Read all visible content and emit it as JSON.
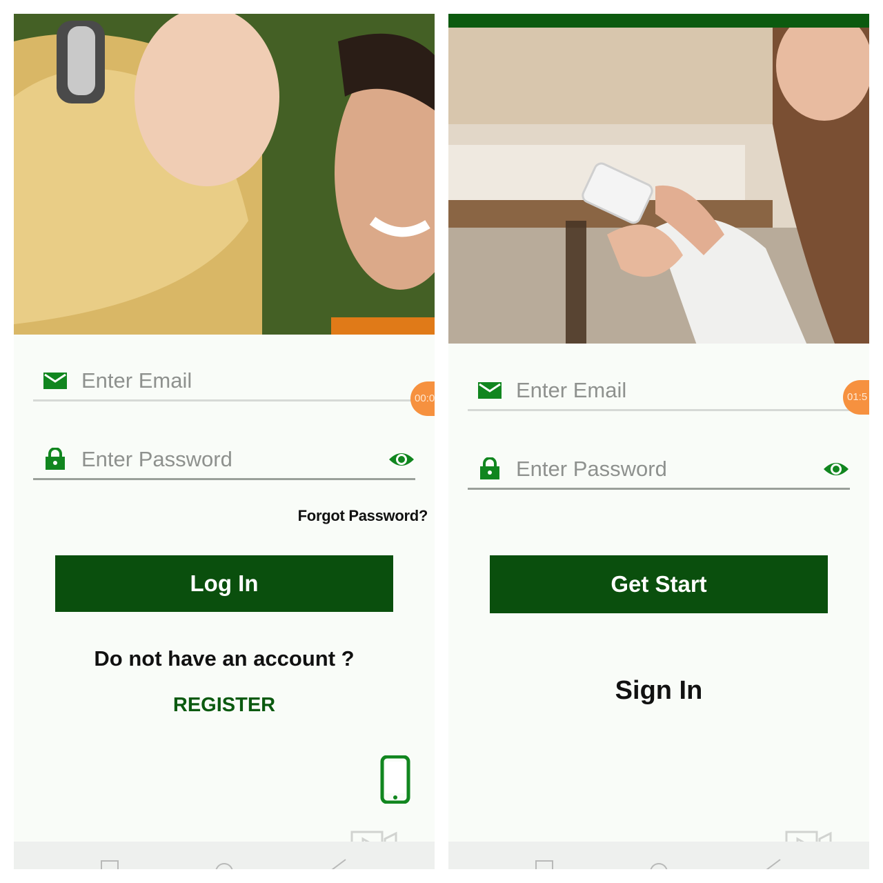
{
  "login_screen": {
    "email_placeholder": "Enter Email",
    "password_placeholder": "Enter Password",
    "timer_text": "00:0",
    "forgot_label": "Forgot Password?",
    "login_label": "Log In",
    "no_account_text": "Do not have an account ?",
    "register_label": "REGISTER",
    "icons": [
      "mail-icon",
      "lock-icon",
      "eye-icon",
      "smartphone-icon",
      "screen-record-icon"
    ]
  },
  "signup_screen": {
    "email_placeholder": "Enter Email",
    "password_placeholder": "Enter Password",
    "timer_text": "01:5",
    "get_start_label": "Get Start",
    "sign_in_label": "Sign In",
    "icons": [
      "mail-icon",
      "lock-icon",
      "eye-icon",
      "screen-record-icon"
    ]
  },
  "colors": {
    "brand_green": "#0a4f0d",
    "icon_green": "#11861f",
    "timer_orange": "#f6913f",
    "background": "#f9fcf8"
  }
}
